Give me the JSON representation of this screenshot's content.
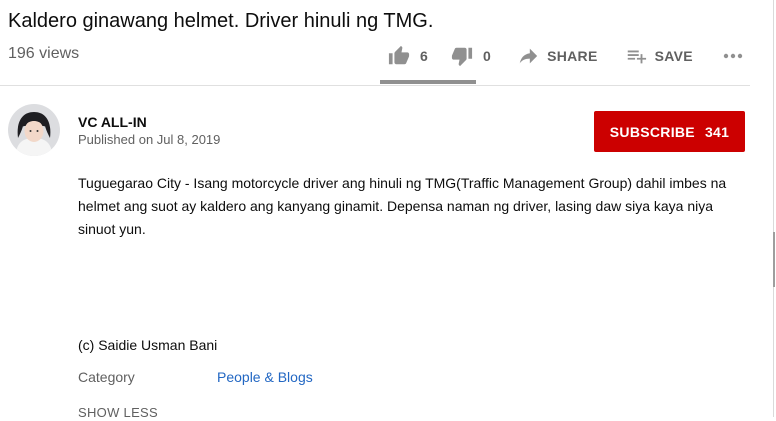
{
  "video": {
    "title": "Kaldero ginawang helmet. Driver hinuli ng TMG.",
    "views": "196 views"
  },
  "actions": {
    "like": {
      "icon": "thumb-up-icon",
      "count": "6"
    },
    "dislike": {
      "icon": "thumb-down-icon",
      "count": "0"
    },
    "share": {
      "icon": "share-icon",
      "label": "SHARE"
    },
    "save": {
      "icon": "playlist-add-icon",
      "label": "SAVE"
    },
    "more": {
      "icon": "more-horiz-icon"
    }
  },
  "channel": {
    "name": "VC ALL-IN",
    "published": "Published on Jul 8, 2019",
    "subscribe_label": "SUBSCRIBE",
    "subscriber_count": "341"
  },
  "description": {
    "text": "Tuguegarao City - Isang motorcycle driver ang hinuli ng TMG(Traffic Management Group) dahil imbes na helmet ang suot ay kaldero ang kanyang ginamit. Depensa naman ng driver, lasing daw siya kaya niya sinuot yun.",
    "credit": "(c) Saidie Usman Bani"
  },
  "metadata": {
    "category_label": "Category",
    "category_value": "People & Blogs"
  },
  "show_less_label": "SHOW LESS",
  "colors": {
    "subscribe_bg": "#cc0000",
    "link": "#2267c3",
    "secondary_text": "#606060",
    "icon": "#909090"
  }
}
